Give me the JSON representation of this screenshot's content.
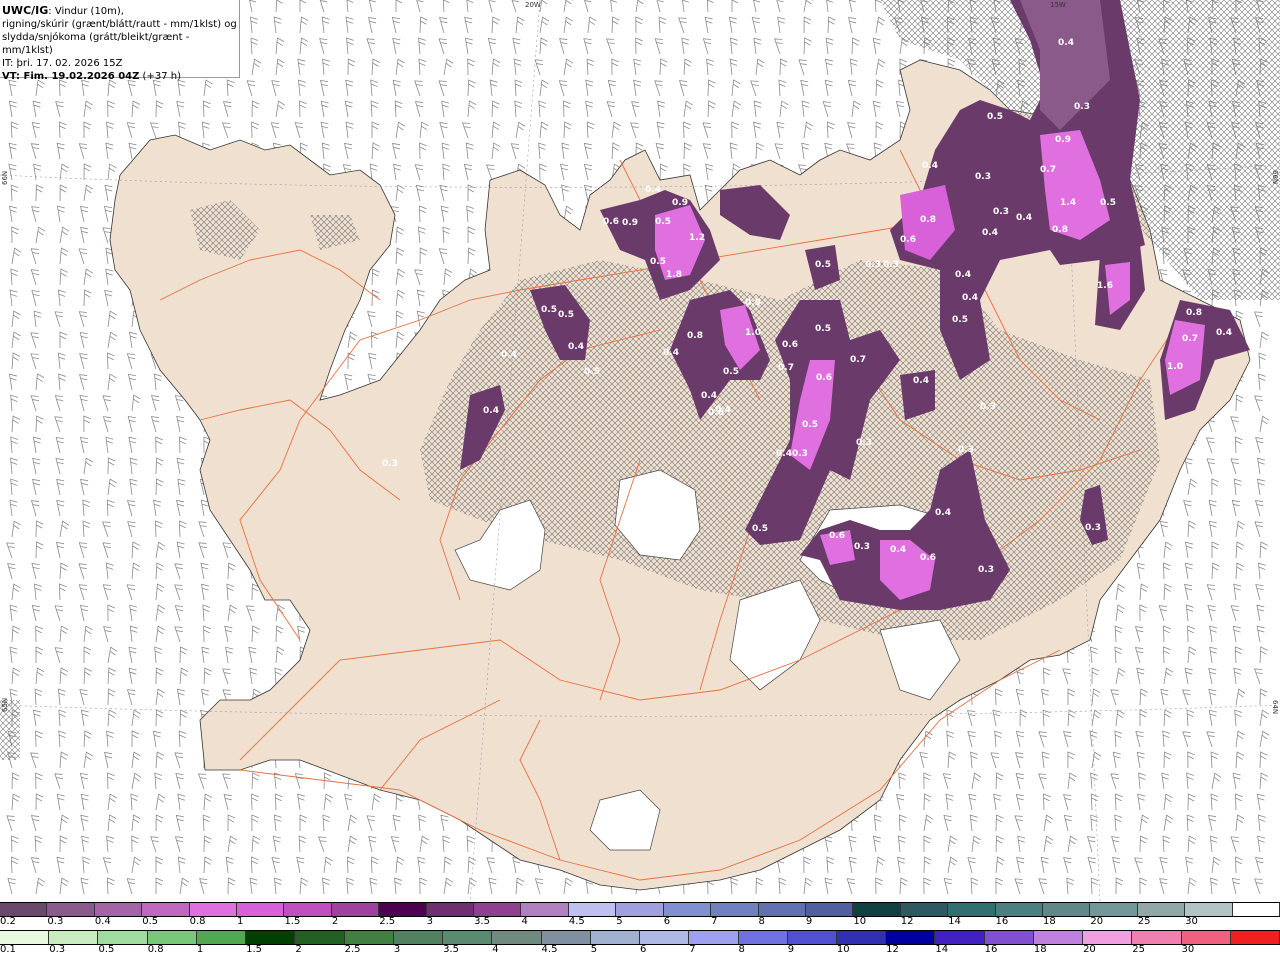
{
  "header": {
    "product": "UWC/IG",
    "line1_rest": ": Vindur (10m),",
    "line2": "rigning/skúrir (grænt/blátt/rautt - mm/1klst) og",
    "line3": "slydda/snjókoma (grátt/bleikt/grænt - mm/1klst)",
    "init_time": "IT: þri. 17. 02. 2026 15Z",
    "valid_time_label": "VT: Fim. 19.02.2026 04Z",
    "valid_offset": " (+37 h)"
  },
  "grid_labels": {
    "lon_20w": "20W",
    "lon_15w": "15W",
    "lat_66n_left": "66N",
    "lat_65n_left": "65N",
    "lat_66n_right": "66N",
    "lat_64n_right": "64N"
  },
  "precip_labels": [
    {
      "text": "0.4",
      "region": "ne"
    },
    {
      "text": "0.3",
      "region": "ne"
    },
    {
      "text": "0.5",
      "region": "ne"
    },
    {
      "text": "0.9",
      "region": "ne"
    },
    {
      "text": "0.7",
      "region": "ne"
    },
    {
      "text": "0.4",
      "region": "ne"
    },
    {
      "text": "0.3",
      "region": "ne"
    },
    {
      "text": "0.3",
      "region": "ne"
    },
    {
      "text": "1.4",
      "region": "ne"
    },
    {
      "text": "0.5",
      "region": "ne"
    },
    {
      "text": "0.4",
      "region": "ne"
    },
    {
      "text": "0.8",
      "region": "ne"
    },
    {
      "text": "0.8",
      "region": "ne"
    },
    {
      "text": "0.4",
      "region": "ne"
    },
    {
      "text": "0.6",
      "region": "ne"
    },
    {
      "text": "0.4",
      "region": "ne"
    },
    {
      "text": "1.6",
      "region": "ne"
    },
    {
      "text": "0.4",
      "region": "ne"
    },
    {
      "text": "0.5",
      "region": "ne"
    },
    {
      "text": "0.3",
      "region": "n"
    },
    {
      "text": "0.3",
      "region": "n"
    },
    {
      "text": "0.5",
      "region": "n"
    },
    {
      "text": "0.4",
      "region": "n"
    },
    {
      "text": "0.9",
      "region": "n"
    },
    {
      "text": "0.5",
      "region": "n"
    },
    {
      "text": "0.9",
      "region": "n"
    },
    {
      "text": "0.6",
      "region": "n"
    },
    {
      "text": "1.2",
      "region": "n"
    },
    {
      "text": "0.5",
      "region": "n"
    },
    {
      "text": "1.8",
      "region": "n"
    },
    {
      "text": "0.9",
      "region": "n"
    },
    {
      "text": "0.5",
      "region": "nw"
    },
    {
      "text": "0.5",
      "region": "nw"
    },
    {
      "text": "0.4",
      "region": "nw"
    },
    {
      "text": "0.5",
      "region": "nw"
    },
    {
      "text": "0.8",
      "region": "n"
    },
    {
      "text": "1.0",
      "region": "n"
    },
    {
      "text": "0.5",
      "region": "n"
    },
    {
      "text": "0.4",
      "region": "n"
    },
    {
      "text": "0.6",
      "region": "n"
    },
    {
      "text": "0.4",
      "region": "n"
    },
    {
      "text": "0.4",
      "region": "n"
    },
    {
      "text": "0.4",
      "region": "n"
    },
    {
      "text": "0.6",
      "region": "c"
    },
    {
      "text": "0.7",
      "region": "c"
    },
    {
      "text": "0.5",
      "region": "c"
    },
    {
      "text": "0.7",
      "region": "c"
    },
    {
      "text": "0.6",
      "region": "c"
    },
    {
      "text": "0.5",
      "region": "c"
    },
    {
      "text": "0.40.3",
      "region": "c"
    },
    {
      "text": "0.3",
      "region": "c"
    },
    {
      "text": "0.4",
      "region": "c"
    },
    {
      "text": "0.3",
      "region": "c"
    },
    {
      "text": "0.3",
      "region": "c"
    },
    {
      "text": "0.5",
      "region": "c"
    },
    {
      "text": "0.4",
      "region": "w"
    },
    {
      "text": "0.3",
      "region": "w"
    },
    {
      "text": "0.8",
      "region": "e"
    },
    {
      "text": "0.4",
      "region": "e"
    },
    {
      "text": "0.7",
      "region": "e"
    },
    {
      "text": "1.0",
      "region": "e"
    },
    {
      "text": "0.3",
      "region": "e"
    },
    {
      "text": "0.6",
      "region": "s"
    },
    {
      "text": "0.3",
      "region": "s"
    },
    {
      "text": "0.4",
      "region": "s"
    },
    {
      "text": "0.6",
      "region": "s"
    },
    {
      "text": "0.4",
      "region": "s"
    },
    {
      "text": "0.3",
      "region": "s"
    }
  ],
  "legend_snow": {
    "colors": [
      "#6a4a6a",
      "#8a5a8a",
      "#a564a5",
      "#c068c0",
      "#e070e0",
      "#d860d8",
      "#c050c0",
      "#a040a0",
      "#500050",
      "#703070",
      "#904090",
      "#b080c0",
      "#c0c0f0",
      "#a0a0e0",
      "#8090d0",
      "#7080c0",
      "#6070b0",
      "#5060a0",
      "#104040",
      "#305860",
      "#307070",
      "#4a8080",
      "#608888",
      "#709898",
      "#90a8a8",
      "#b0c4c4",
      "#ffffff"
    ],
    "labels": [
      "0.2",
      "0.3",
      "0.4",
      "0.5",
      "0.8",
      "1",
      "1.5",
      "2",
      "2.5",
      "3",
      "3.5",
      "4",
      "4.5",
      "5",
      "6",
      "7",
      "8",
      "9",
      "10",
      "12",
      "14",
      "16",
      "18",
      "20",
      "25",
      "30"
    ]
  },
  "legend_rain": {
    "colors": [
      "#e8f8e0",
      "#c8ecc0",
      "#a0dca0",
      "#78c878",
      "#50a850",
      "#004000",
      "#206020",
      "#408040",
      "#508060",
      "#5a8a70",
      "#708a80",
      "#8090a0",
      "#a0b0d0",
      "#b0b8e8",
      "#a0a0f0",
      "#7070e0",
      "#5050d0",
      "#3030b0",
      "#0000a0",
      "#4020c0",
      "#8050d0",
      "#c080e0",
      "#f0a0e0",
      "#f080b0",
      "#f06080",
      "#f02020"
    ],
    "labels": [
      "0.1",
      "0.3",
      "0.5",
      "0.8",
      "1",
      "1.5",
      "2",
      "2.5",
      "3",
      "3.5",
      "4",
      "4.5",
      "5",
      "6",
      "7",
      "8",
      "9",
      "10",
      "12",
      "14",
      "16",
      "18",
      "20",
      "25",
      "30"
    ]
  },
  "colors": {
    "land": "#f0e0d0",
    "sea": "#ffffff",
    "roads": "#e87040",
    "glacier": "#ffffff",
    "snow_light": "#8a5a8a",
    "snow_mid": "#6a3a6a",
    "snow_heavy": "#e070e0",
    "wind_barb": "#888888",
    "hatch": "#666666"
  }
}
